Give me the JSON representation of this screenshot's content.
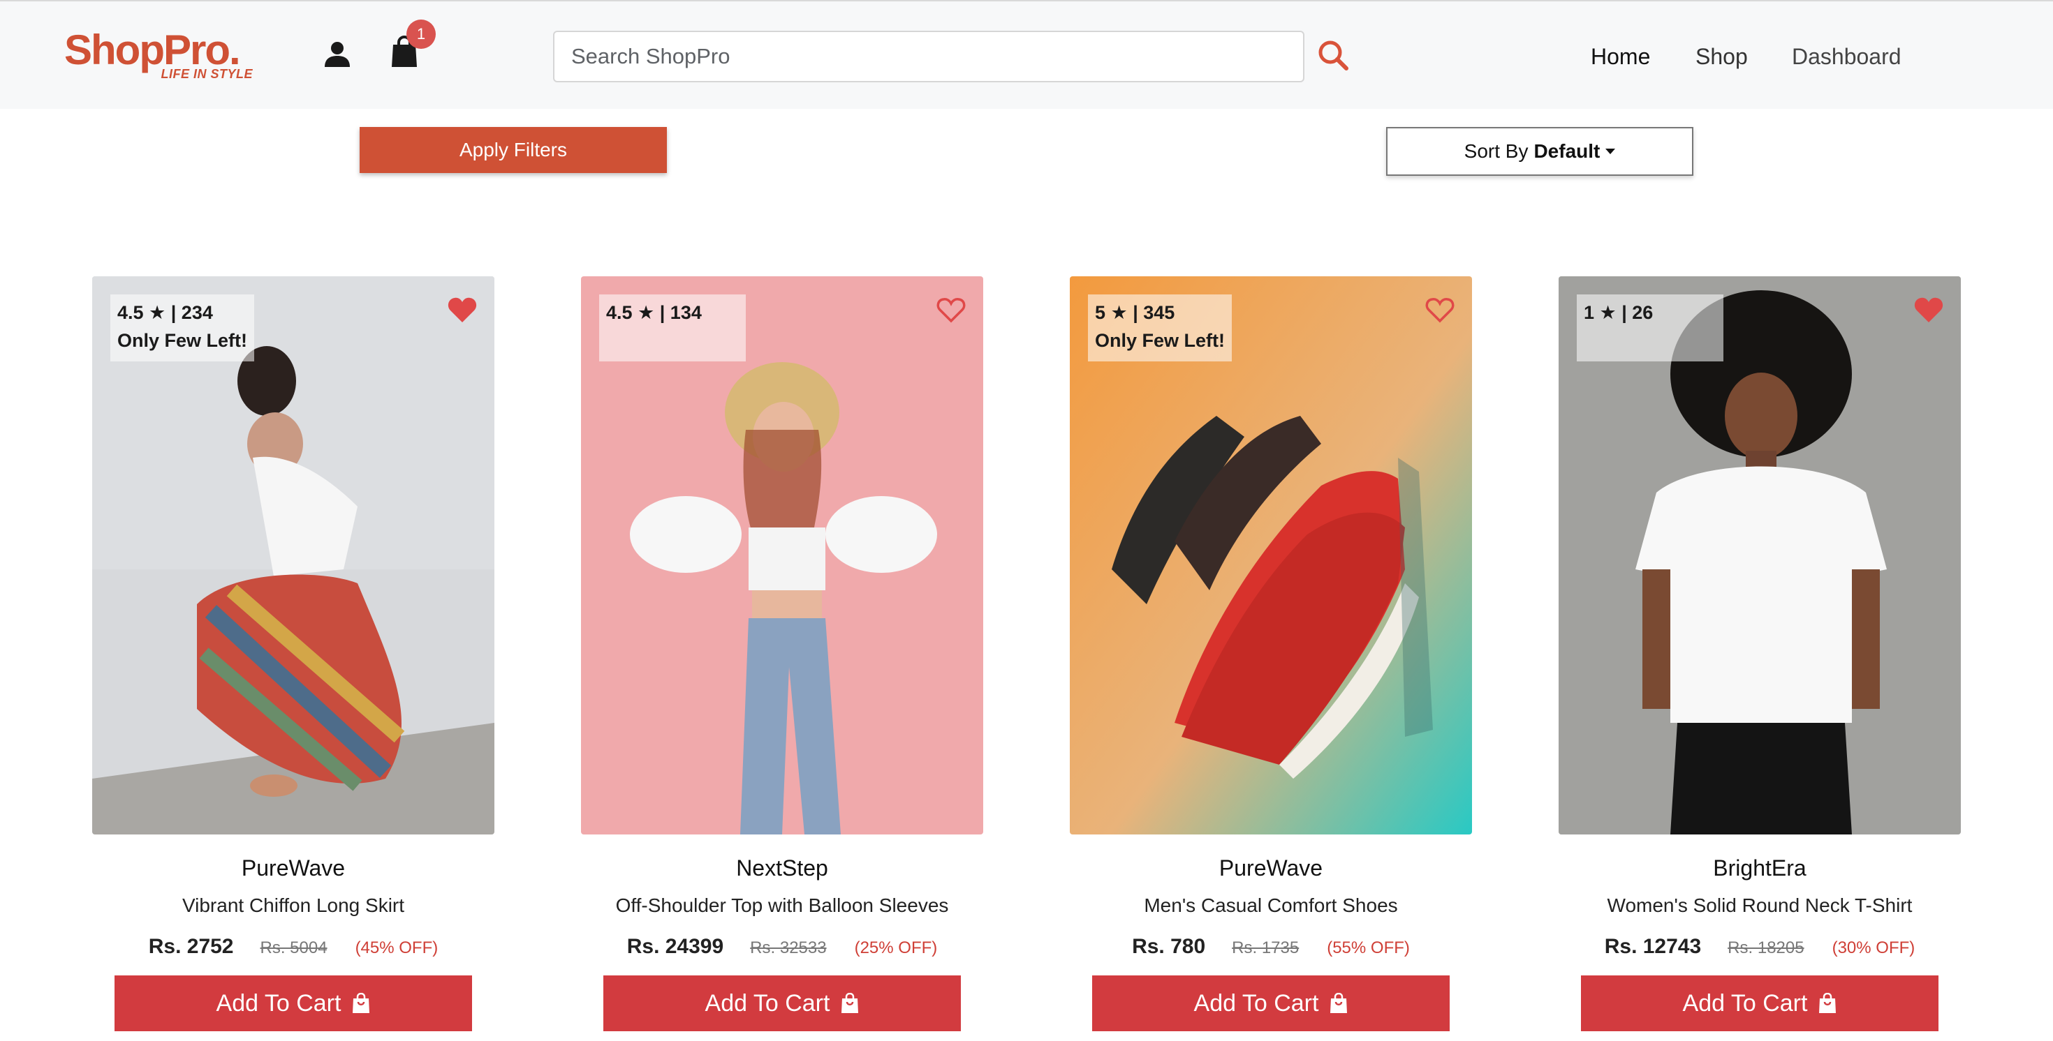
{
  "header": {
    "logo_main": "ShopPro.",
    "logo_tagline": "LIFE IN STYLE",
    "cart_count": "1",
    "search_placeholder": "Search ShopPro",
    "nav": [
      "Home",
      "Shop",
      "Dashboard"
    ]
  },
  "toolbar": {
    "apply_filters_label": "Apply Filters",
    "sort_prefix": "Sort By",
    "sort_value": "Default"
  },
  "products": [
    {
      "rating": "4.5 ★ | 234",
      "stock_note": "Only Few Left!",
      "wishlisted": true,
      "brand": "PureWave",
      "name": "Vibrant Chiffon Long Skirt",
      "price": "Rs. 2752",
      "mrp": "Rs. 5004",
      "discount": "(45% OFF)",
      "cta": "Add To Cart"
    },
    {
      "rating": "4.5 ★ | 134",
      "stock_note": "",
      "wishlisted": false,
      "brand": "NextStep",
      "name": "Off-Shoulder Top with Balloon Sleeves",
      "price": "Rs. 24399",
      "mrp": "Rs. 32533",
      "discount": "(25% OFF)",
      "cta": "Add To Cart"
    },
    {
      "rating": "5 ★ | 345",
      "stock_note": "Only Few Left!",
      "wishlisted": false,
      "brand": "PureWave",
      "name": "Men's Casual Comfort Shoes",
      "price": "Rs. 780",
      "mrp": "Rs. 1735",
      "discount": "(55% OFF)",
      "cta": "Add To Cart"
    },
    {
      "rating": "1 ★ | 26",
      "stock_note": "",
      "wishlisted": true,
      "brand": "BrightEra",
      "name": "Women's Solid Round Neck T-Shirt",
      "price": "Rs. 12743",
      "mrp": "Rs. 18205",
      "discount": "(30% OFF)",
      "cta": "Add To Cart"
    }
  ],
  "colors": {
    "brand": "#cf5135",
    "cta": "#d23b3f",
    "heart": "#e04848"
  }
}
